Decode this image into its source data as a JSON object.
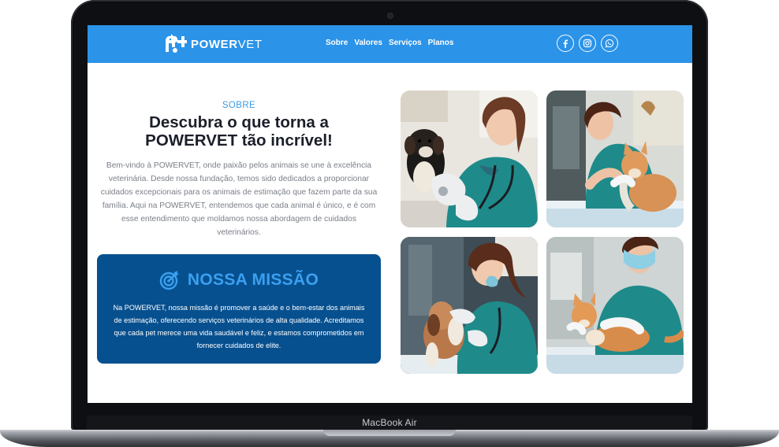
{
  "device": {
    "label": "MacBook Air"
  },
  "brand": {
    "name_bold": "POWER",
    "name_light": "VET"
  },
  "nav": {
    "links": [
      {
        "label": "Sobre"
      },
      {
        "label": "Valores"
      },
      {
        "label": "Serviços"
      },
      {
        "label": "Planos"
      }
    ]
  },
  "socials": [
    {
      "icon": "facebook-icon"
    },
    {
      "icon": "instagram-icon"
    },
    {
      "icon": "whatsapp-icon"
    }
  ],
  "about": {
    "eyebrow": "SOBRE",
    "title_line1": "Descubra o que torna a",
    "title_line2": "POWERVET tão incrível!",
    "text": "Bem-vindo à POWERVET, onde paixão pelos animais se une à excelência veterinária. Desde nossa fundação, temos sido dedicados a proporcionar cuidados excepcionais para os animais de estimação que fazem parte da sua família. Aqui na POWERVET, entendemos que cada animal é único, e é com esse entendimento que moldamos nossa abordagem de cuidados veterinários."
  },
  "mission": {
    "icon": "target-icon",
    "title": "NOSSA MISSÃO",
    "text": "Na POWERVET, nossa missão é promover a saúde e o bem-estar dos animais de estimação, oferecendo serviços veterinários de alta qualidade. Acreditamos que cada pet merece uma vida saudável e feliz, e estamos comprometidos em fornecer cuidados de elite."
  },
  "colors": {
    "nav_bg": "#2b93e8",
    "mission_bg": "#07508f",
    "accent": "#3aa0f0",
    "scrub_teal": "#1f8a8a"
  }
}
